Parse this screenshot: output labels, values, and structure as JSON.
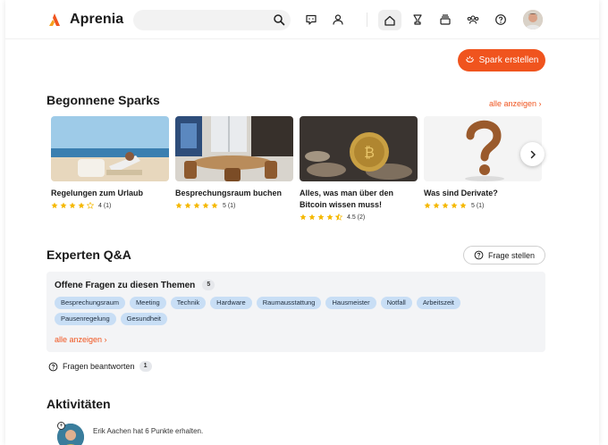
{
  "app": {
    "name": "Aprenia",
    "accent": "#f0541e"
  },
  "header": {
    "search": {
      "placeholder": "",
      "value": ""
    },
    "icons": [
      "chat-bubble-icon",
      "people-icon",
      "home-icon",
      "trophy-icon",
      "stack-icon",
      "community-icon",
      "help-icon"
    ]
  },
  "spark_button": {
    "label": "Spark erstellen"
  },
  "sparks": {
    "title": "Begonnene Sparks",
    "show_all": "alle anzeigen",
    "items": [
      {
        "title": "Regelungen zum Urlaub",
        "rating": 4,
        "count": "4 (1)"
      },
      {
        "title": "Besprechungsraum buchen",
        "rating": 5,
        "count": "5 (1)"
      },
      {
        "title": "Alles, was man über den Bitcoin wissen muss!",
        "rating": 4.5,
        "count": "4.5 (2)"
      },
      {
        "title": "Was sind Derivate?",
        "rating": 5,
        "count": "5 (1)"
      }
    ]
  },
  "qa": {
    "title": "Experten Q&A",
    "ask_button": "Frage stellen",
    "open_questions_title": "Offene Fragen zu diesen Themen",
    "open_questions_count": "5",
    "topics": [
      "Besprechungsraum",
      "Meeting",
      "Technik",
      "Hardware",
      "Raumausstattung",
      "Hausmeister",
      "Notfall",
      "Arbeitszeit",
      "Pausenregelung",
      "Gesundheit"
    ],
    "show_all": "alle anzeigen",
    "answer_label": "Fragen beantworten",
    "answer_count": "1"
  },
  "activities": {
    "title": "Aktivitäten",
    "items": [
      {
        "text": "Erik Aachen hat 6 Punkte erhalten."
      }
    ]
  }
}
